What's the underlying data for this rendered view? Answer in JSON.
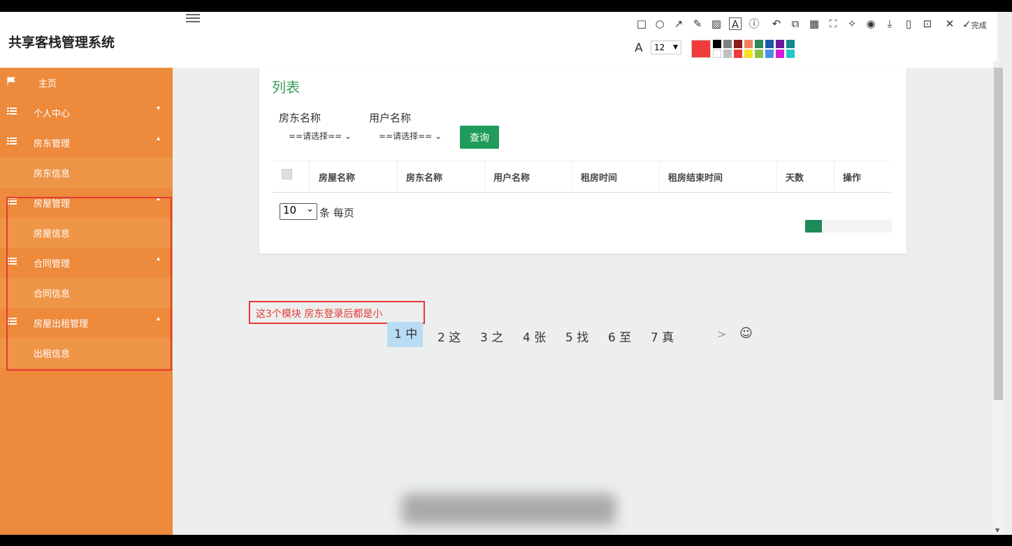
{
  "app": {
    "title": "共享客栈管理系统"
  },
  "sidebar": {
    "items": [
      {
        "label": "主页",
        "sub": false,
        "caret": false
      },
      {
        "label": "个人中心",
        "sub": false,
        "caret": true
      },
      {
        "label": "房东管理",
        "sub": false,
        "caret": true
      },
      {
        "label": "房东信息",
        "sub": true,
        "caret": false
      },
      {
        "label": "房屋管理",
        "sub": false,
        "caret": true
      },
      {
        "label": "房屋信息",
        "sub": true,
        "caret": false
      },
      {
        "label": "合同管理",
        "sub": false,
        "caret": true
      },
      {
        "label": "合同信息",
        "sub": true,
        "caret": false
      },
      {
        "label": "房屋出租管理",
        "sub": false,
        "caret": true
      },
      {
        "label": "出租信息",
        "sub": true,
        "caret": false
      }
    ]
  },
  "main": {
    "card_title": "列表",
    "filters": {
      "landlord_label": "房东名称",
      "user_label": "用户名称",
      "landlord_select": "==请选择==",
      "user_select": "==请选择==",
      "query_button": "查询"
    },
    "table": {
      "columns": [
        "房屋名称",
        "房东名称",
        "用户名称",
        "租房时间",
        "租房结束时间",
        "天数",
        "操作"
      ]
    },
    "pagination": {
      "page_size": "10",
      "page_size_suffix": "条 每页"
    }
  },
  "annotation": {
    "text": "这3个模块 房东登录后都是小"
  },
  "ime": {
    "candidates": [
      "1 中",
      "2 这",
      "3 之",
      "4 张",
      "5 找",
      "6 至",
      "7 真"
    ],
    "more": ">",
    "emoji": "☺"
  },
  "toolbar": {
    "done_label": "完成",
    "font_size": "12",
    "current_color": "#f03b3b",
    "palette": [
      "#000000",
      "#808080",
      "#8b1a1a",
      "#f08060",
      "#2e8b57",
      "#1e5aa8",
      "#6a1b9a",
      "#138a8a",
      "#ffffff",
      "#c0c0c0",
      "#f03b3b",
      "#f5e320",
      "#8bc34a",
      "#4a90e2",
      "#d81bd8",
      "#21c6c6"
    ],
    "icons": [
      "rectangle-icon",
      "circle-icon",
      "arrow-icon",
      "pencil-icon",
      "mosaic-icon",
      "text-icon",
      "number-icon",
      "undo-icon",
      "pin-icon",
      "ocr-icon",
      "scan-icon",
      "translate-icon",
      "record-icon",
      "download-icon",
      "phone-icon",
      "bookmark-icon",
      "close-icon"
    ]
  }
}
